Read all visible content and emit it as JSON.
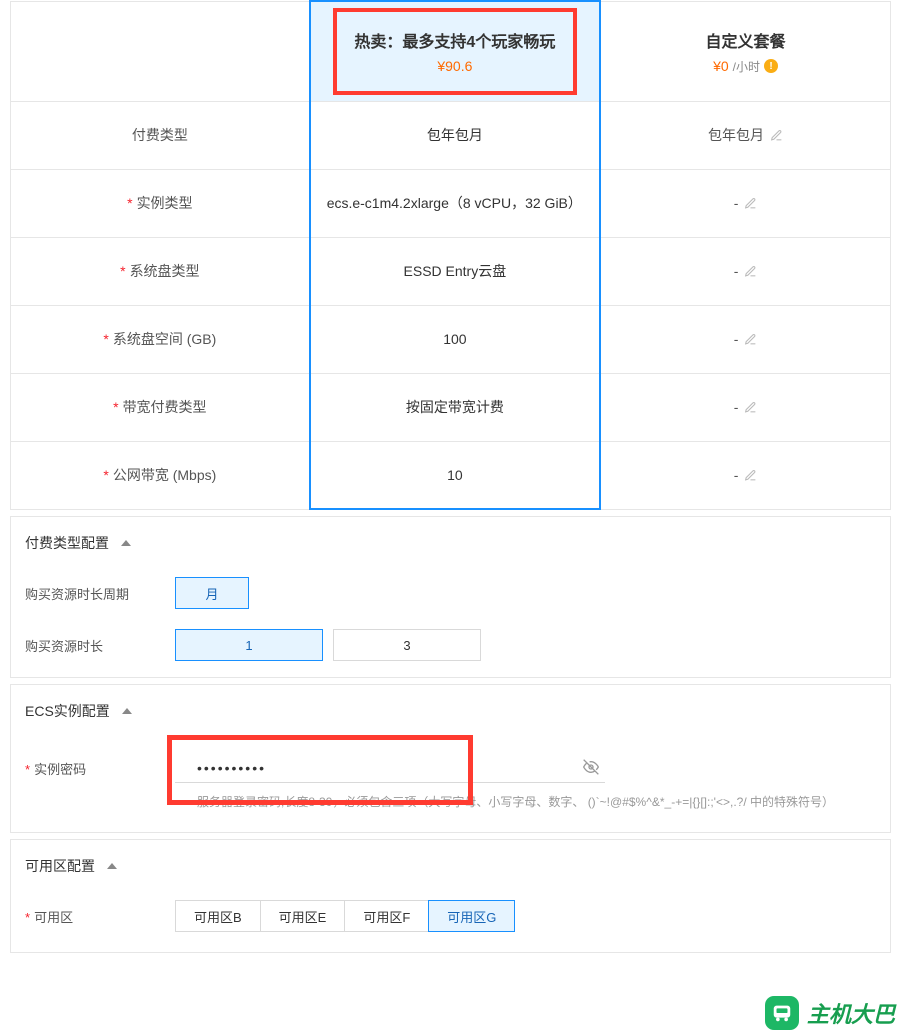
{
  "plans": {
    "hot": {
      "title": "热卖：最多支持4个玩家畅玩",
      "price": "¥90.6"
    },
    "custom": {
      "title": "自定义套餐",
      "price": "¥0",
      "unit": "/小时"
    }
  },
  "rows": {
    "billing": {
      "label": "付费类型",
      "hot": "包年包月",
      "custom": "包年包月",
      "required": false
    },
    "instance": {
      "label": "实例类型",
      "hot": "ecs.e-c1m4.2xlarge（8 vCPU，32 GiB）",
      "custom": "-",
      "required": true
    },
    "disk_type": {
      "label": "系统盘类型",
      "hot": "ESSD Entry云盘",
      "custom": "-",
      "required": true
    },
    "disk_size": {
      "label": "系统盘空间 (GB)",
      "hot": "100",
      "custom": "-",
      "required": true
    },
    "bw_billing": {
      "label": "带宽付费类型",
      "hot": "按固定带宽计费",
      "custom": "-",
      "required": true
    },
    "bw": {
      "label": "公网带宽 (Mbps)",
      "hot": "10",
      "custom": "-",
      "required": true
    }
  },
  "sections": {
    "billing_config": {
      "title": "付费类型配置",
      "period_label": "购买资源时长周期",
      "period_options": [
        "月"
      ],
      "period_selected": "月",
      "duration_label": "购买资源时长",
      "duration_options": [
        "1",
        "3"
      ],
      "duration_selected": "1"
    },
    "ecs_config": {
      "title": "ECS实例配置",
      "pw_label": "实例密码",
      "pw_value": "••••••••••",
      "pw_hint": "服务器登录密码,长度8-30，必须包含三项（大写字母、小写字母、数字、 ()`~!@#$%^&*_-+=|{}[]:;'<>,.?/ 中的特殊符号）"
    },
    "zone_config": {
      "title": "可用区配置",
      "zone_label": "可用区",
      "zone_options": [
        "可用区B",
        "可用区E",
        "可用区F",
        "可用区G"
      ],
      "zone_selected": "可用区G"
    }
  },
  "brand": "主机大巴"
}
